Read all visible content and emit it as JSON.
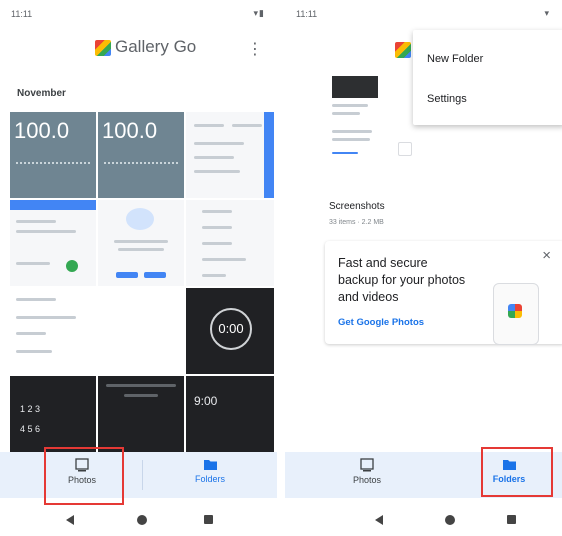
{
  "left_screen": {
    "status": {
      "time": "11:11",
      "indicators": "▾▮"
    },
    "app_title": "Gallery Go",
    "overflow_glyph": "⋮",
    "section_title": "November",
    "tiles": {
      "calc1_value": "100.0",
      "calc2_value": "100.0",
      "clock_time": "0:00",
      "alarm_time": "9:00",
      "digits": [
        "1 2 3",
        "4 5 6"
      ]
    },
    "bottom_nav": {
      "photos_label": "Photos",
      "folders_label": "Folders"
    }
  },
  "right_screen": {
    "status": {
      "time": "11:11",
      "indicators": "▾"
    },
    "menu": {
      "items": [
        "New Folder",
        "Settings"
      ]
    },
    "folder": {
      "name": "Screenshots",
      "meta": "33 items · 2.2 MB"
    },
    "promo": {
      "text": "Fast and secure backup for your photos and videos",
      "link": "Get Google Photos",
      "close_glyph": "×"
    },
    "bottom_nav": {
      "photos_label": "Photos",
      "folders_label": "Folders"
    }
  },
  "colors": {
    "accent": "#1a73e8",
    "highlight": "#e53935",
    "nav_bg": "#e8f0fb"
  },
  "icons": [
    "gallery-go-logo",
    "overflow-menu-icon",
    "photos-icon",
    "folder-icon",
    "close-icon",
    "back-icon",
    "home-icon",
    "recents-icon"
  ]
}
